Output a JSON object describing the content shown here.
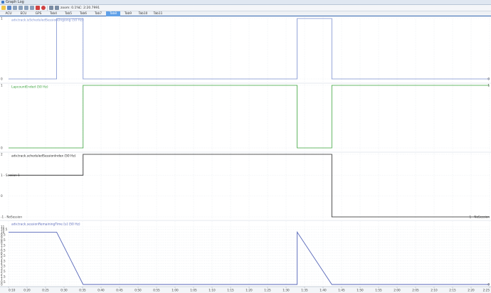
{
  "window": {
    "title": "Graph Log"
  },
  "toolbar": {
    "zoom_label": "zoom: 0.1%",
    "position_label": "C: 2:20.7991"
  },
  "tabs": [
    {
      "label": "ACU",
      "active": false
    },
    {
      "label": "ECU",
      "active": false
    },
    {
      "label": "GPS",
      "active": false
    },
    {
      "label": "Tab4",
      "active": false
    },
    {
      "label": "Tab5",
      "active": false
    },
    {
      "label": "Tab6",
      "active": false
    },
    {
      "label": "Tab7",
      "active": false
    },
    {
      "label": "Tab8",
      "active": true
    },
    {
      "label": "Tab9",
      "active": false
    },
    {
      "label": "Tab10",
      "active": false
    },
    {
      "label": "Tab11",
      "active": false
    }
  ],
  "colors": {
    "blue_series": "#7b8fd0",
    "green_series": "#3aa33a",
    "black_series": "#222222",
    "active_tab": "#5fa0e8"
  },
  "chart_data": [
    {
      "type": "line",
      "title": "adv.track.isScheduledSessionOngoing (50 Hz)",
      "color": "#7b8fd0",
      "y_tick_labels": [
        "1",
        "0"
      ],
      "ylim": [
        0,
        1
      ],
      "points": [
        [
          0,
          0
        ],
        [
          0.1,
          0
        ],
        [
          0.1,
          1
        ],
        [
          0.155,
          1
        ],
        [
          0.155,
          0
        ],
        [
          0.6,
          0
        ],
        [
          0.6,
          1
        ],
        [
          0.672,
          1
        ],
        [
          0.672,
          0
        ],
        [
          1,
          0
        ]
      ],
      "end_label": "0"
    },
    {
      "type": "line",
      "title": "LapcountEnded (50 Hz)",
      "color": "#3aa33a",
      "y_tick_labels": [
        "1",
        "0"
      ],
      "ylim": [
        0,
        1
      ],
      "points": [
        [
          0,
          0
        ],
        [
          0.155,
          0
        ],
        [
          0.155,
          1
        ],
        [
          0.6,
          1
        ],
        [
          0.6,
          0
        ],
        [
          0.672,
          0
        ],
        [
          0.672,
          1
        ],
        [
          1,
          1
        ]
      ],
      "end_label": "1"
    },
    {
      "type": "line",
      "title": "adv.track.scheduledSessionIndex (50 Hz)",
      "color": "#222222",
      "y_tick_labels": [
        "2",
        "1 - Session 1",
        "0",
        "-1 - NoSession"
      ],
      "ylim": [
        -1,
        2
      ],
      "points": [
        [
          0,
          1
        ],
        [
          0.155,
          1
        ],
        [
          0.155,
          2
        ],
        [
          0.672,
          2
        ],
        [
          0.672,
          -1
        ],
        [
          1,
          -1
        ]
      ],
      "end_label": "-1 - NoSession"
    },
    {
      "type": "line",
      "title": "adv.track.sessionRemainingTime [s] (50 Hz)",
      "color": "#5566b8",
      "y_tick_labels": [
        "11",
        "10.5",
        "10",
        "9.5",
        "9",
        "8.5",
        "8",
        "7.5",
        "7",
        "6.5",
        "6",
        "5.5",
        "5",
        "4.5",
        "4",
        "3.5",
        "3",
        "2.5",
        "2",
        "1.5",
        "1",
        "0.5",
        "0"
      ],
      "ylim": [
        0,
        11
      ],
      "points": [
        [
          0,
          10
        ],
        [
          0.1,
          10
        ],
        [
          0.155,
          0
        ],
        [
          0.6,
          0
        ],
        [
          0.6,
          10
        ],
        [
          0.672,
          0
        ],
        [
          1,
          0
        ]
      ],
      "end_label": "0"
    }
  ],
  "x_axis": {
    "ticks": [
      "0:10",
      "0:20",
      "0:25",
      "0:30",
      "0:35",
      "0:40",
      "0:45",
      "0:50",
      "0:55",
      "1:00",
      "1:05",
      "1:10",
      "1:15",
      "1:20",
      "1:25",
      "1:30",
      "1:35",
      "1:40",
      "1:45",
      "1:50",
      "1:55",
      "2:00",
      "2:05",
      "2:10",
      "2:15",
      "2:20",
      "2:25"
    ]
  }
}
